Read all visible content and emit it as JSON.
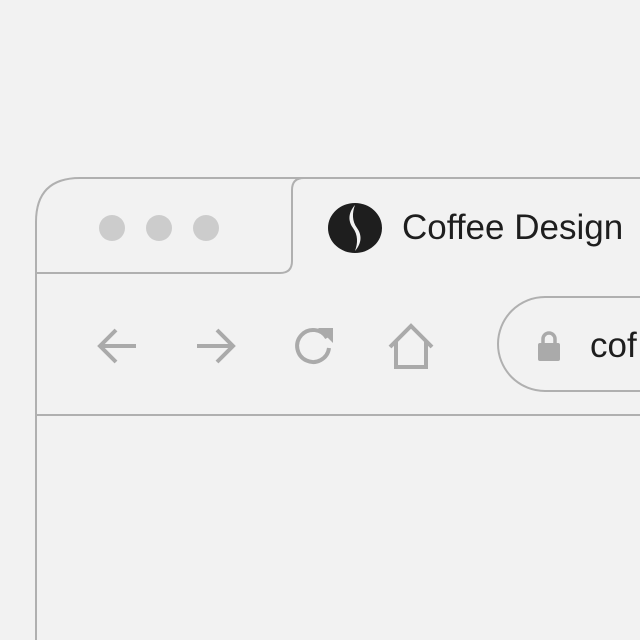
{
  "window": {
    "traffic_lights": [
      "close",
      "minimize",
      "maximize"
    ]
  },
  "tab": {
    "logo_icon": "coffee-bean-logo-icon",
    "title": "Coffee Design"
  },
  "toolbar": {
    "back_icon": "arrow-left-icon",
    "forward_icon": "arrow-right-icon",
    "reload_icon": "reload-icon",
    "home_icon": "home-icon"
  },
  "address_bar": {
    "lock_icon": "lock-icon",
    "url": "cof"
  },
  "colors": {
    "background": "#f2f2f2",
    "outline": "#b0b0b0",
    "icon_gray": "#aaaaaa",
    "traffic_light": "#cccccc",
    "text": "#1e1e1e"
  }
}
